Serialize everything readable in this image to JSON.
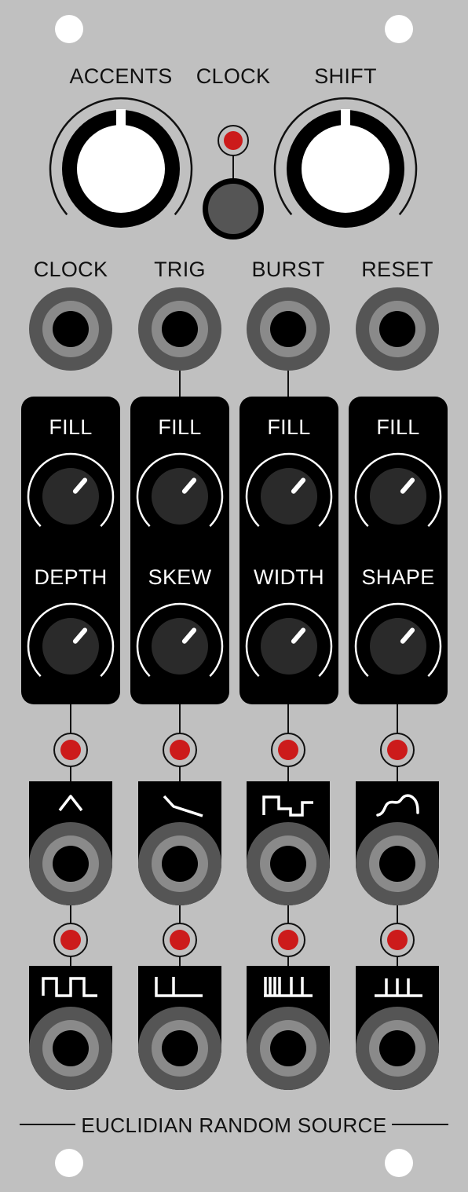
{
  "module": {
    "name": "EUCLIDIAN RANDOM SOURCE",
    "colors": {
      "panel": "#c0c0c0",
      "ink": "#111111",
      "led_red": "#cc1b1b",
      "jack_outer": "#555555",
      "jack_ring": "#8a8a8a",
      "button": "#555555"
    }
  },
  "top": {
    "accents_label": "ACCENTS",
    "clock_label": "CLOCK",
    "shift_label": "SHIFT"
  },
  "inputs": {
    "labels": [
      "CLOCK",
      "TRIG",
      "BURST",
      "RESET"
    ]
  },
  "channels": [
    {
      "fill_label": "FILL",
      "param_label": "DEPTH",
      "cv_icon": "triangle-wave-icon",
      "gate_icon": "square-wave-icon"
    },
    {
      "fill_label": "FILL",
      "param_label": "SKEW",
      "cv_icon": "skewed-ramp-icon",
      "gate_icon": "sparse-gate-icon"
    },
    {
      "fill_label": "FILL",
      "param_label": "WIDTH",
      "cv_icon": "pulse-width-icon",
      "gate_icon": "burst-gate-icon"
    },
    {
      "fill_label": "FILL",
      "param_label": "SHAPE",
      "cv_icon": "curved-shape-icon",
      "gate_icon": "pulse-gate-icon"
    }
  ]
}
